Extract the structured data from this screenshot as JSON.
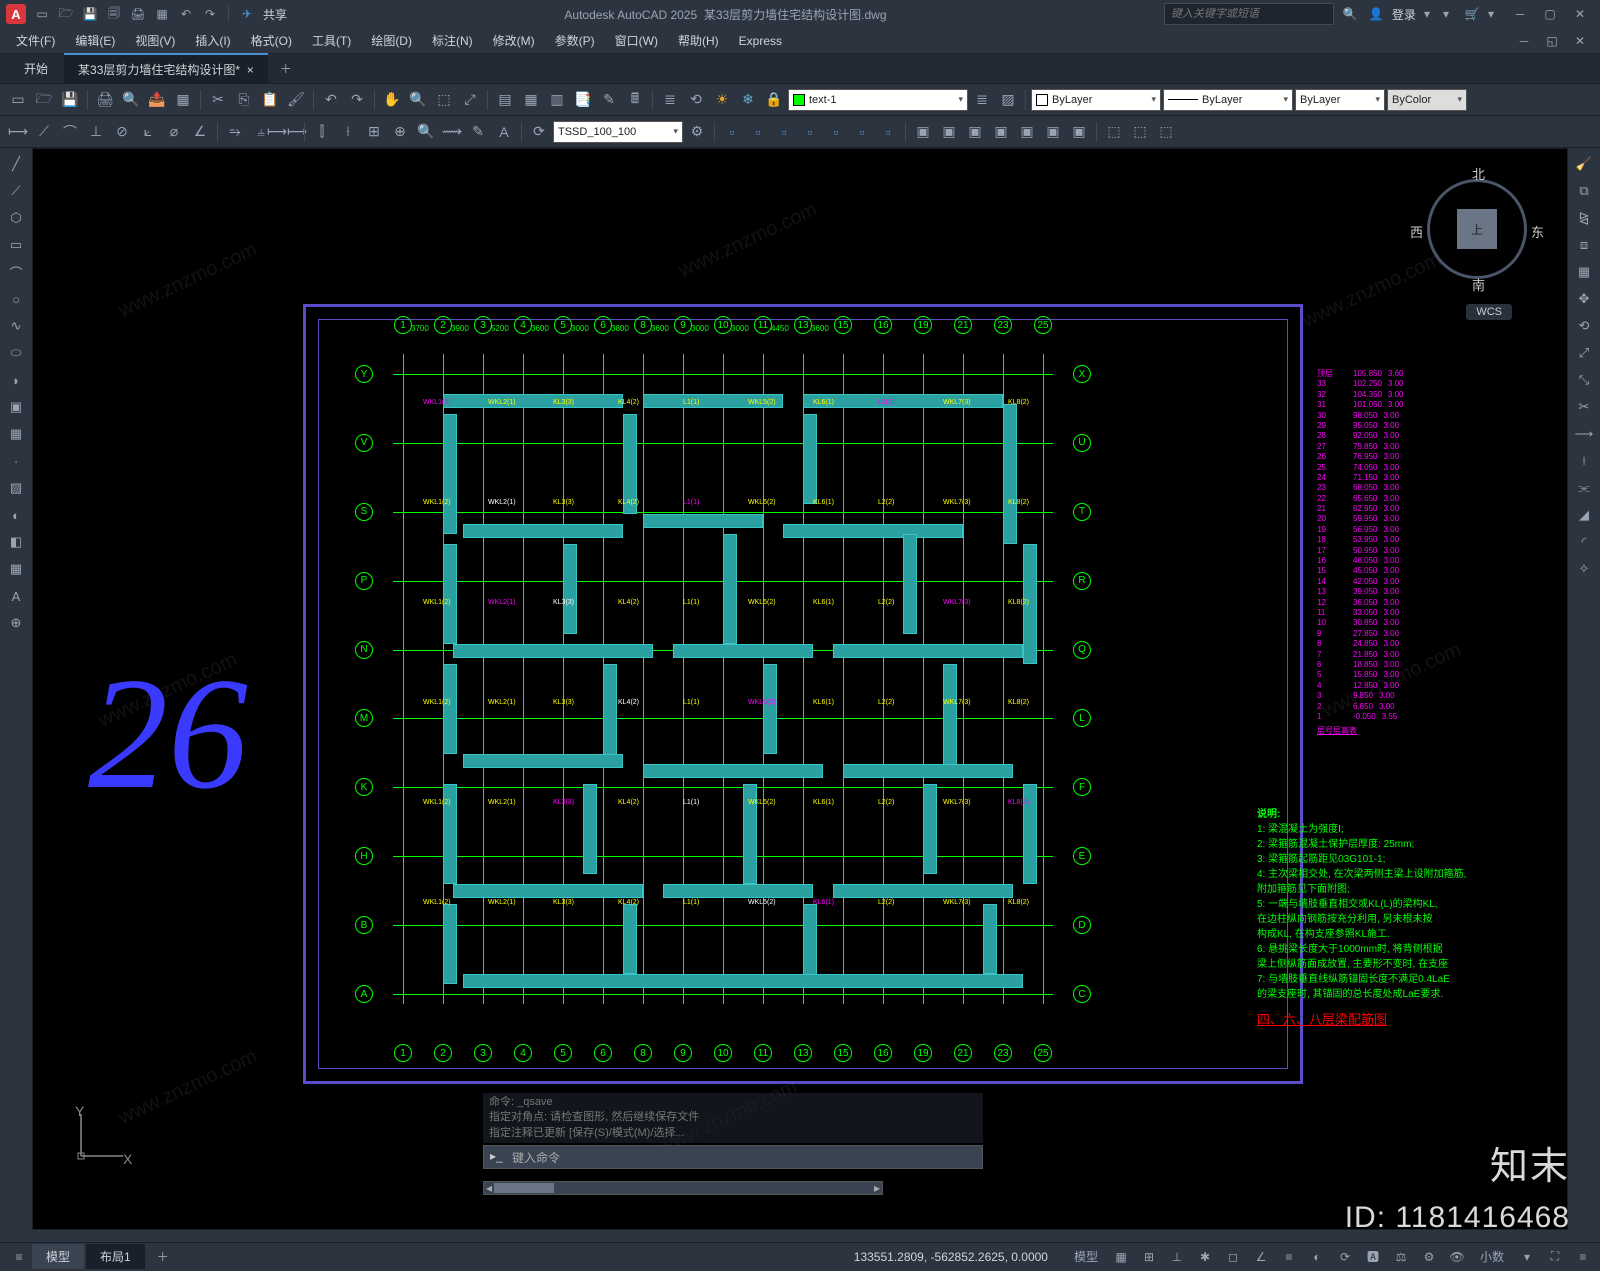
{
  "app": {
    "name": "Autodesk AutoCAD 2025",
    "doc": "某33层剪力墙住宅结构设计图.dwg",
    "badge": "A",
    "search_placeholder": "键入关键字或短语",
    "login": "登录",
    "share": "共享"
  },
  "menus": [
    {
      "label": "文件(F)"
    },
    {
      "label": "编辑(E)"
    },
    {
      "label": "视图(V)"
    },
    {
      "label": "插入(I)"
    },
    {
      "label": "格式(O)"
    },
    {
      "label": "工具(T)"
    },
    {
      "label": "绘图(D)"
    },
    {
      "label": "标注(N)"
    },
    {
      "label": "修改(M)"
    },
    {
      "label": "参数(P)"
    },
    {
      "label": "窗口(W)"
    },
    {
      "label": "帮助(H)"
    },
    {
      "label": "Express"
    }
  ],
  "tabs": {
    "start": "开始",
    "doc": "某33层剪力墙住宅结构设计图*"
  },
  "layer": {
    "current": "text-1",
    "bylayer": "ByLayer",
    "color": "ByColor"
  },
  "style_dd": "TSSD_100_100",
  "viewcube": {
    "face": "上",
    "n": "北",
    "s": "南",
    "e": "东",
    "w": "西",
    "wcs": "WCS"
  },
  "drawing": {
    "page_number": "26",
    "grid_cols": [
      "1",
      "2",
      "3",
      "4",
      "5",
      "6",
      "8",
      "9",
      "10",
      "11",
      "13",
      "15",
      "16",
      "19",
      "21",
      "23",
      "25"
    ],
    "grid_rows": [
      "Y",
      "V",
      "S",
      "P",
      "N",
      "M",
      "K",
      "H",
      "B",
      "A"
    ],
    "grid_rows_r": [
      "X",
      "U",
      "T",
      "R",
      "Q",
      "L",
      "F",
      "E",
      "D",
      "C"
    ],
    "top_dims": [
      "3700",
      "3900",
      "5200",
      "3600",
      "3000",
      "3800",
      "3600",
      "3000",
      "3000",
      "4450",
      "3600"
    ],
    "title": "四、六、八层梁配筋图",
    "notes_head": "说明:",
    "notes": [
      "1: 梁混凝土为强度I;",
      "2: 梁箍筋混凝土保护层厚度: 25mm;",
      "3: 梁箍筋起筋距见03G101-1;",
      "4: 主次梁相交处, 在次梁两侧主梁上设附加箍筋,",
      "   附加箍筋见下面附图;",
      "5: 一端与墙肢垂直相交或KL(L)的梁构KL,",
      "   在边柱纵向钢筋按充分利用, 另未根未按",
      "   构成KL, 在构支座参照KL施工.",
      "6: 悬挑梁长度大于1000mm时, 将背侧根据",
      "   梁上侧纵筋面成放置, 主要形不变时, 在支座",
      "7: 与墙肢垂直线纵筋锚固长度不满足0.4LaE",
      "   的梁支座时, 其锚固的总长度处成LaE要求."
    ],
    "levels": [
      [
        "顶层",
        "105.850",
        "3.60"
      ],
      [
        "33",
        "102.250",
        "3.00"
      ],
      [
        "32",
        "104.350",
        "3.00"
      ],
      [
        "31",
        "101.050",
        "3.00"
      ],
      [
        "30",
        "98.050",
        "3.00"
      ],
      [
        "29",
        "95.050",
        "3.00"
      ],
      [
        "28",
        "92.050",
        "3.00"
      ],
      [
        "27",
        "79.850",
        "3.00"
      ],
      [
        "26",
        "76.950",
        "3.00"
      ],
      [
        "25",
        "74.050",
        "3.00"
      ],
      [
        "24",
        "71.150",
        "3.00"
      ],
      [
        "23",
        "68.050",
        "3.00"
      ],
      [
        "22",
        "65.650",
        "3.00"
      ],
      [
        "21",
        "62.950",
        "3.00"
      ],
      [
        "20",
        "59.950",
        "3.00"
      ],
      [
        "19",
        "56.950",
        "3.00"
      ],
      [
        "18",
        "53.950",
        "3.00"
      ],
      [
        "17",
        "50.950",
        "3.00"
      ],
      [
        "16",
        "48.050",
        "3.00"
      ],
      [
        "15",
        "45.050",
        "3.00"
      ],
      [
        "14",
        "42.050",
        "3.00"
      ],
      [
        "13",
        "39.050",
        "3.00"
      ],
      [
        "12",
        "36.050",
        "3.00"
      ],
      [
        "11",
        "33.050",
        "3.00"
      ],
      [
        "10",
        "30.850",
        "3.00"
      ],
      [
        "9",
        "27.850",
        "3.00"
      ],
      [
        "8",
        "24.850",
        "3.00"
      ],
      [
        "7",
        "21.850",
        "3.00"
      ],
      [
        "6",
        "18.850",
        "3.00"
      ],
      [
        "5",
        "15.850",
        "3.00"
      ],
      [
        "4",
        "12.850",
        "3.00"
      ],
      [
        "3",
        "9.850",
        "3.00"
      ],
      [
        "2",
        "6.850",
        "3.00"
      ],
      [
        "1",
        "-0.050",
        "3.55"
      ]
    ],
    "level_footer": "层号层高表"
  },
  "cmdline": {
    "hist1": "命令: _qsave",
    "hist2": "指定对角点: 请检查图形, 然后继续保存文件",
    "hist3": "指定注释已更新 [保存(S)/模式(M)/选择...",
    "prompt": "键入命令"
  },
  "bottom_tabs": {
    "model": "模型",
    "layout1": "布局1"
  },
  "status": {
    "coords": "133551.2809, -562852.2625, 0.0000",
    "model": "模型",
    "scale": "小数"
  },
  "ucs": {
    "x": "X",
    "y": "Y"
  },
  "watermark": {
    "brand": "知末",
    "id": "ID: 1181416468",
    "url": "www.znzmo.com"
  }
}
